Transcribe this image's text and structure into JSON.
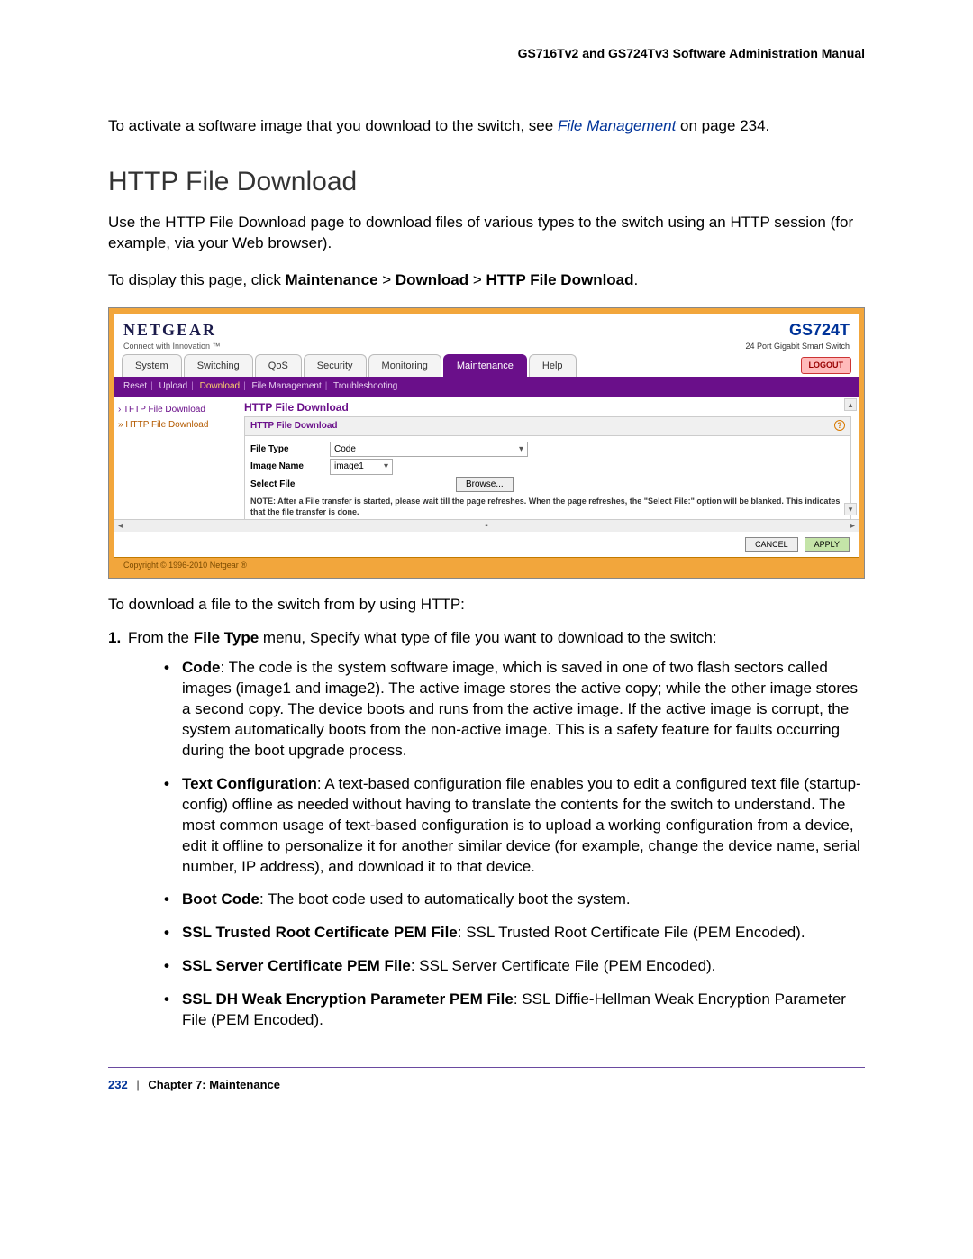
{
  "header": {
    "manual_title": "GS716Tv2 and GS724Tv3 Software Administration Manual"
  },
  "intro": {
    "text_before": "To activate a software image that you download to the switch, see ",
    "link": "File Management",
    "text_after": " on page 234."
  },
  "section": {
    "heading": "HTTP File Download"
  },
  "desc": {
    "p1": "Use the HTTP File Download page to download files of various types to the switch using an HTTP session (for example, via your Web browser).",
    "p2_pre": "To display this page, click ",
    "p2_b1": "Maintenance",
    "p2_s1": " > ",
    "p2_b2": "Download",
    "p2_s2": " > ",
    "p2_b3": "HTTP File Download",
    "p2_post": "."
  },
  "ui": {
    "brand": "NETGEAR",
    "tagline": "Connect with Innovation ™",
    "model": "GS724T",
    "model_desc": "24 Port Gigabit Smart Switch",
    "tabs": [
      "System",
      "Switching",
      "QoS",
      "Security",
      "Monitoring",
      "Maintenance",
      "Help"
    ],
    "active_tab": "Maintenance",
    "logout": "LOGOUT",
    "subnav": {
      "items": [
        "Reset",
        "Upload",
        "Download",
        "File Management",
        "Troubleshooting"
      ],
      "active": "Download"
    },
    "sidebar": {
      "item1": "› TFTP File Download",
      "item2": "» HTTP File Download"
    },
    "panel": {
      "main_title": "HTTP File Download",
      "head": "HTTP File Download",
      "rows": {
        "file_type_lbl": "File Type",
        "file_type_val": "Code",
        "image_name_lbl": "Image Name",
        "image_name_val": "image1",
        "select_file_lbl": "Select File",
        "browse_btn": "Browse..."
      },
      "note": "NOTE: After a File transfer is started, please wait till the page refreshes. When the page refreshes, the \"Select File:\" option will be blanked. This indicates that the file transfer is done."
    },
    "actions": {
      "cancel": "CANCEL",
      "apply": "APPLY"
    },
    "copyright": "Copyright © 1996-2010 Netgear ®"
  },
  "after_shot": "To download a file to the switch from by using HTTP:",
  "step1": {
    "num": "1.",
    "pre": "From the ",
    "b": "File Type",
    "post": " menu, Specify what type of file you want to download to the switch:"
  },
  "bullets": {
    "code": {
      "label": "Code",
      "text": ": The code is the system software image, which is saved in one of two flash sectors called images (image1 and image2). The active image stores the active copy; while the other image stores a second copy. The device boots and runs from the active image. If the active image is corrupt, the system automatically boots from the non-active image. This is a safety feature for faults occurring during the boot upgrade process."
    },
    "textcfg": {
      "label": "Text Configuration",
      "text": ": A text-based configuration file enables you to edit a configured text file (startup-config) offline as needed without having to translate the contents for the switch to understand. The most common usage of text-based configuration is to upload a working configuration from a device, edit it offline to personalize it for another similar device (for example, change the device name, serial number, IP address), and download it to that device."
    },
    "boot": {
      "label": "Boot Code",
      "text": ": The boot code used to automatically boot the system."
    },
    "sslroot": {
      "label": "SSL Trusted Root Certificate PEM File",
      "text": ": SSL Trusted Root Certificate File (PEM Encoded)."
    },
    "sslserver": {
      "label": "SSL Server Certificate PEM File",
      "text": ": SSL Server Certificate File (PEM Encoded)."
    },
    "ssldh": {
      "label": "SSL DH Weak Encryption Parameter PEM File",
      "text": ": SSL Diffie-Hellman Weak Encryption Parameter File (PEM Encoded)."
    }
  },
  "footer": {
    "page": "232",
    "sep": "|",
    "chapter": "Chapter 7:  Maintenance"
  }
}
